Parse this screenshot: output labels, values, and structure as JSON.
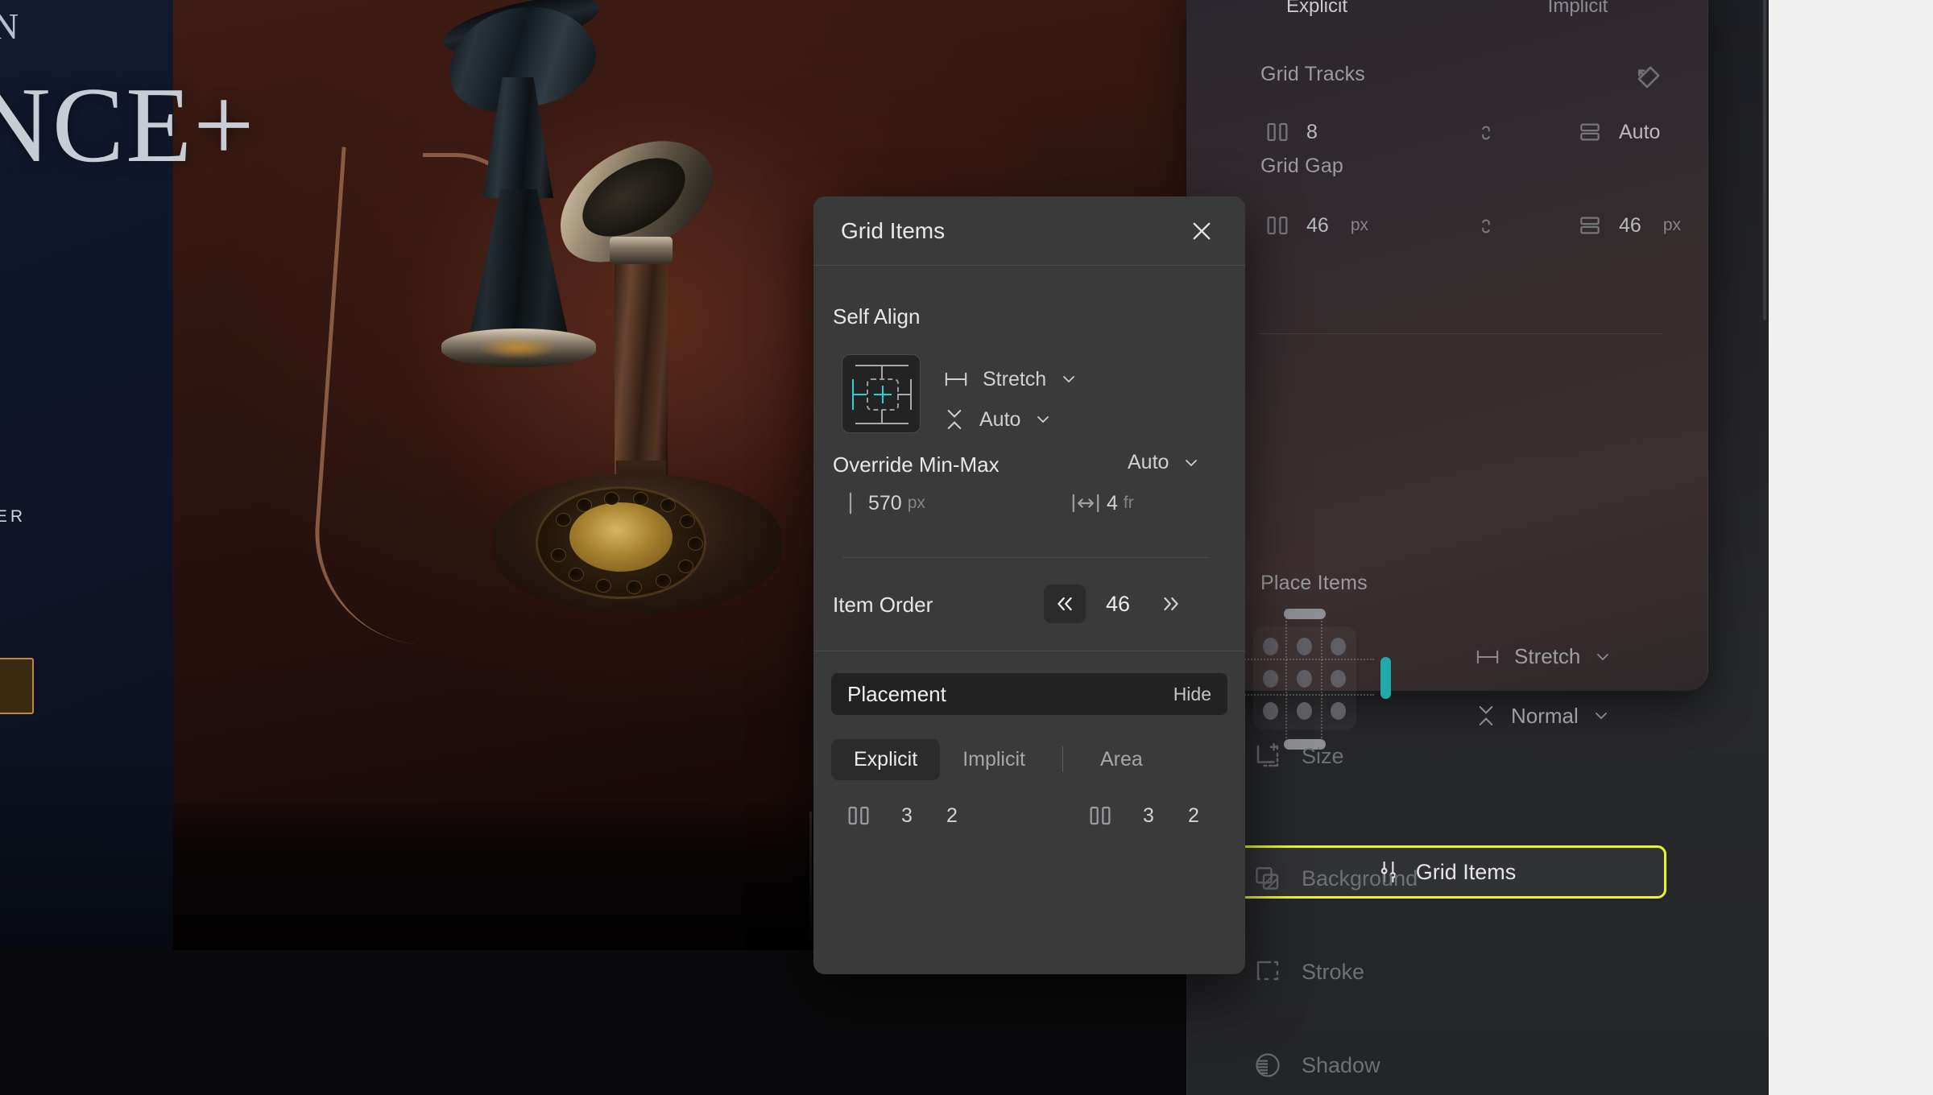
{
  "canvas": {
    "poster": {
      "title_small": "N",
      "title_word": "NCE+",
      "sub_word": "TER",
      "photo_alt": "antique-candlestick-telephone"
    }
  },
  "sidebar": {
    "top_tabs": [
      {
        "label": "Explicit",
        "active": true
      },
      {
        "label": "Implicit",
        "active": false
      }
    ],
    "grid_tracks": {
      "label": "Grid Tracks",
      "tag_icon": "tag-icon",
      "columns_icon": "columns-icon",
      "columns_value": "8",
      "link_icon": "link-broken-icon",
      "rows_icon": "rows-icon",
      "rows_value": "Auto"
    },
    "grid_gap": {
      "label": "Grid Gap",
      "columns_icon": "columns-icon",
      "column_gap": "46",
      "column_gap_unit": "px",
      "link_icon": "link-broken-icon",
      "rows_icon": "rows-icon",
      "row_gap": "46",
      "row_gap_unit": "px"
    },
    "place_items": {
      "label": "Place Items",
      "justify_icon": "horizontal-align-icon",
      "justify_value": "Stretch",
      "align_icon": "vertical-align-icon",
      "align_value": "Normal"
    },
    "grid_items_button": {
      "label": "Grid Items",
      "icon": "sliders-icon",
      "highlight_color": "#e8f526"
    },
    "menu": [
      {
        "label": "Size",
        "icon": "size-icon"
      },
      {
        "label": "Background",
        "icon": "background-icon"
      },
      {
        "label": "Stroke",
        "icon": "stroke-icon"
      },
      {
        "label": "Shadow",
        "icon": "shadow-icon"
      }
    ]
  },
  "dialog": {
    "title": "Grid Items",
    "close_icon": "close-icon",
    "self_align": {
      "label": "Self Align",
      "preview_icon": "self-align-preview",
      "justify_icon": "horizontal-align-icon",
      "justify_value": "Stretch",
      "align_icon": "vertical-align-icon",
      "align_value": "Auto"
    },
    "override_minmax": {
      "label": "Override Min-Max",
      "mode": "Auto",
      "min_icon": "min-bound-icon",
      "min_value": "570",
      "min_unit": "px",
      "max_icon": "max-bound-icon",
      "max_value": "4",
      "max_unit": "fr"
    },
    "item_order": {
      "label": "Item Order",
      "prev_icon": "chevrons-left-icon",
      "value": "46",
      "next_icon": "chevrons-right-icon"
    },
    "placement": {
      "label": "Placement",
      "toggle_label": "Hide",
      "tabs": [
        {
          "label": "Explicit",
          "active": true
        },
        {
          "label": "Implicit",
          "active": false
        },
        {
          "label": "Area",
          "active": false
        }
      ],
      "rows": [
        {
          "icon": "columns-icon",
          "start": "3",
          "end": "2"
        },
        {
          "icon": "columns-icon",
          "start": "3",
          "end": "2"
        }
      ]
    }
  }
}
